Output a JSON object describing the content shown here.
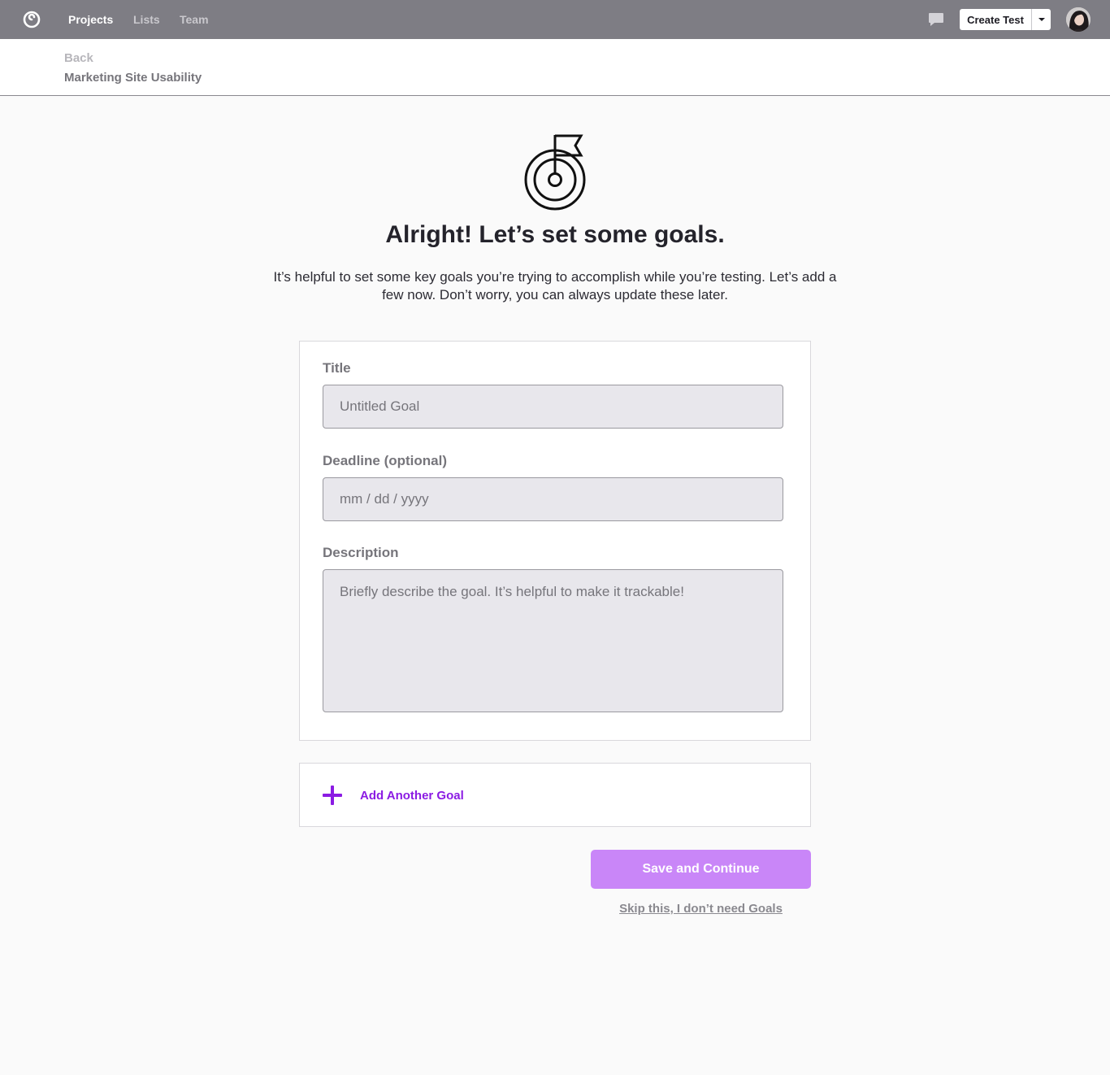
{
  "nav": {
    "logo_icon": "brand-logo-icon",
    "items": [
      {
        "label": "Projects",
        "active": true
      },
      {
        "label": "Lists",
        "active": false
      },
      {
        "label": "Team",
        "active": false
      }
    ],
    "chat_icon": "chat-bubble-icon",
    "create_test_label": "Create Test",
    "create_caret_icon": "caret-down-icon"
  },
  "subheader": {
    "back_label": "Back",
    "project_name": "Marketing Site Usability"
  },
  "hero": {
    "icon": "target-flag-icon",
    "heading": "Alright! Let’s set some goals.",
    "intro": "It’s helpful to set some key goals you’re trying to accomplish while you’re testing. Let’s add a few now. Don’t worry, you can always update these later."
  },
  "goal_form": {
    "title_label": "Title",
    "title_placeholder": "Untitled Goal",
    "title_value": "",
    "deadline_label": "Deadline (optional)",
    "deadline_placeholder": "mm / dd / yyyy",
    "deadline_value": "",
    "description_label": "Description",
    "description_placeholder": "Briefly describe the goal. It’s helpful to make it trackable!",
    "description_value": ""
  },
  "add_goal": {
    "icon": "plus-icon",
    "label": "Add Another Goal"
  },
  "actions": {
    "save_label": "Save and Continue",
    "skip_label": "Skip this, I don’t need Goals"
  },
  "colors": {
    "topbar": "#7e7d84",
    "accent": "#8b1be3",
    "primary_button": "#c986f8",
    "field_bg": "#e8e7ec"
  }
}
